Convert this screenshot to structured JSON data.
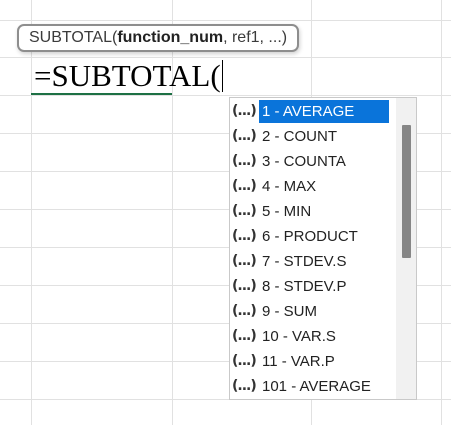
{
  "tooltip": {
    "function_name": "SUBTOTAL",
    "open_paren": "(",
    "current_arg": "function_num",
    "rest_args": ", ref1, ...)"
  },
  "cell": {
    "formula_text": "=SUBTOTAL("
  },
  "dropdown": {
    "icon_glyph": "(...)",
    "items": [
      {
        "label": "1 - AVERAGE",
        "selected": true
      },
      {
        "label": "2 - COUNT"
      },
      {
        "label": "3 - COUNTA"
      },
      {
        "label": "4 - MAX"
      },
      {
        "label": "5 - MIN"
      },
      {
        "label": "6 - PRODUCT"
      },
      {
        "label": "7 - STDEV.S"
      },
      {
        "label": "8 - STDEV.P"
      },
      {
        "label": "9 - SUM"
      },
      {
        "label": "10 - VAR.S"
      },
      {
        "label": "11 - VAR.P"
      },
      {
        "label": "101 - AVERAGE"
      }
    ]
  },
  "colors": {
    "selection": "#0a74da",
    "cell_border": "#1d7044",
    "gridline": "#e1e1e1"
  }
}
